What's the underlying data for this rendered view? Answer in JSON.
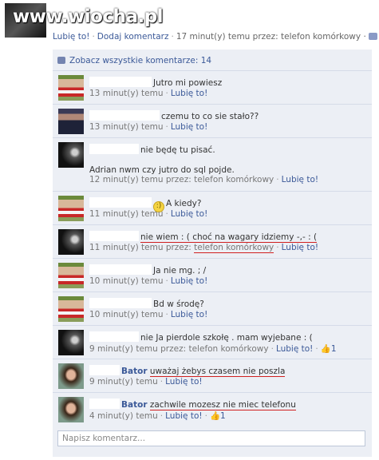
{
  "watermark": "www.wiocha.pl",
  "top_meta": {
    "like": "Lubię to!",
    "add_comment": "Dodaj komentarz",
    "time": "17 minut(y) temu przez: telefon komórkowy ·"
  },
  "see_all": "Zobacz wszystkie komentarze: 14",
  "comments": [
    {
      "author": "",
      "avatar": "soccer-avatar",
      "text": "Jutro mi powiesz",
      "time": "13 minut(y) temu",
      "via": "",
      "like": "Lubię to!",
      "likes": ""
    },
    {
      "author": "",
      "avatar": "suit-avatar",
      "text": "czemu to co sie stało??",
      "time": "13 minut(y) temu",
      "via": "",
      "like": "Lubię to!",
      "likes": ""
    },
    {
      "author": "",
      "avatar": "dark-avatar",
      "text": "nie będę tu pisać.",
      "text2": "Adrian nwm czy jutro do sql pojde.",
      "time": "12 minut(y) temu przez:",
      "via": "telefon komórkowy",
      "like": "Lubię to!",
      "likes": ""
    },
    {
      "author": "",
      "avatar": "soccer-avatar",
      "text": "A kiedy?",
      "time": "11 minut(y) temu",
      "via": "",
      "like": "Lubię to!",
      "likes": ""
    },
    {
      "author": "",
      "avatar": "dark-avatar",
      "text": "nie wiem : ( choć na wagary idziemy -,- : (",
      "time": "11 minut(y) temu przez:",
      "via": "telefon komórkowy",
      "like": "Lubię to!",
      "likes": ""
    },
    {
      "author": "",
      "avatar": "soccer-avatar",
      "text": "Ja nie mg. ; /",
      "time": "10 minut(y) temu",
      "via": "",
      "like": "Lubię to!",
      "likes": ""
    },
    {
      "author": "",
      "avatar": "soccer-avatar",
      "text": "Bd w środę?",
      "time": "10 minut(y) temu",
      "via": "",
      "like": "Lubię to!",
      "likes": ""
    },
    {
      "author": "",
      "avatar": "dark-avatar",
      "text": "nie Ja pierdole szkołę . mam wyjebane : (",
      "time": "9 minut(y) temu przez:",
      "via": "telefon komórkowy",
      "like": "Lubię to!",
      "likes": "1"
    },
    {
      "author": "Bator",
      "avatar": "girl-avatar",
      "text": "uważaj żebys czasem nie poszla",
      "time": "9 minut(y) temu",
      "via": "",
      "like": "Lubię to!",
      "likes": ""
    },
    {
      "author": "Bator",
      "avatar": "girl-avatar",
      "text": "zachwile mozesz nie miec telefonu",
      "time": "4 minut(y) temu",
      "via": "",
      "like": "Lubię to!",
      "likes": "1"
    }
  ],
  "new_comment_placeholder": "Napisz komentarz..."
}
